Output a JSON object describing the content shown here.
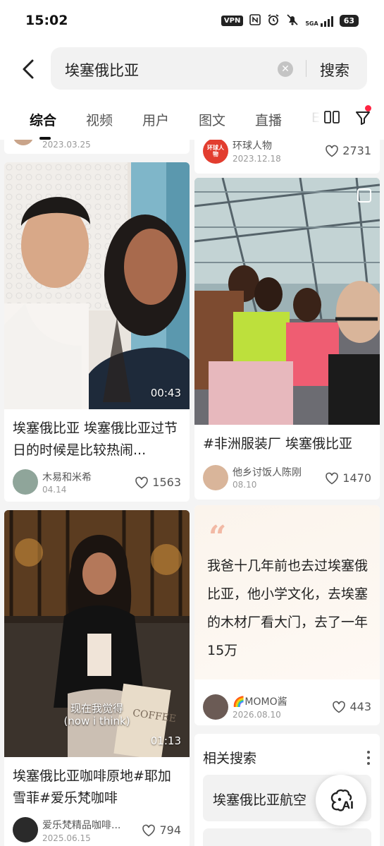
{
  "status_bar": {
    "time": "15:02",
    "vpn": "VPN",
    "network": "5GA",
    "battery": "63"
  },
  "search": {
    "query": "埃塞俄比亚",
    "button_label": "搜索"
  },
  "tabs": [
    {
      "label": "综合",
      "active": true
    },
    {
      "label": "视频",
      "active": false
    },
    {
      "label": "用户",
      "active": false
    },
    {
      "label": "图文",
      "active": false
    },
    {
      "label": "直播",
      "active": false
    },
    {
      "label": "E",
      "active": false
    }
  ],
  "partial_top": {
    "left": {
      "date": "2023.03.25"
    },
    "right": {
      "author": "环球人物",
      "date": "2023.12.18",
      "likes": "2731",
      "avatar_text": "环球人物"
    }
  },
  "cards": [
    {
      "title": "埃塞俄比亚 埃塞俄比亚过节日的时候是比较热闹...",
      "duration": "00:43",
      "author": "木易和米希",
      "date": "04.14",
      "likes": "1563"
    },
    {
      "title": "#非洲服装厂 埃塞俄比亚",
      "author": "他乡讨饭人陈刚",
      "date": "08.10",
      "likes": "1470"
    },
    {
      "title": "埃塞俄比亚咖啡原地#耶加雪菲#爱乐梵咖啡",
      "duration": "01:13",
      "caption_cn": "现在我觉得",
      "caption_en": "(now i think)",
      "cup_text": "COFFEE",
      "author": "爱乐梵精品咖啡...",
      "date": "2025.06.15",
      "likes": "794"
    },
    {
      "quote": "我爸十几年前也去过埃塞俄比亚，他小学文化，去埃塞的木材厂看大门，去了一年15万",
      "quote_mark": "“",
      "author": "🌈MOMO酱",
      "date": "2026.08.10",
      "likes": "443"
    }
  ],
  "related": {
    "title": "相关搜索",
    "items": [
      "埃塞俄比亚航空"
    ]
  },
  "ai_button": {
    "label": "AI"
  },
  "colors": {
    "accent": "#ff2442",
    "quote_mark": "#f2b9a5",
    "highlight": "#cfe3f7"
  }
}
